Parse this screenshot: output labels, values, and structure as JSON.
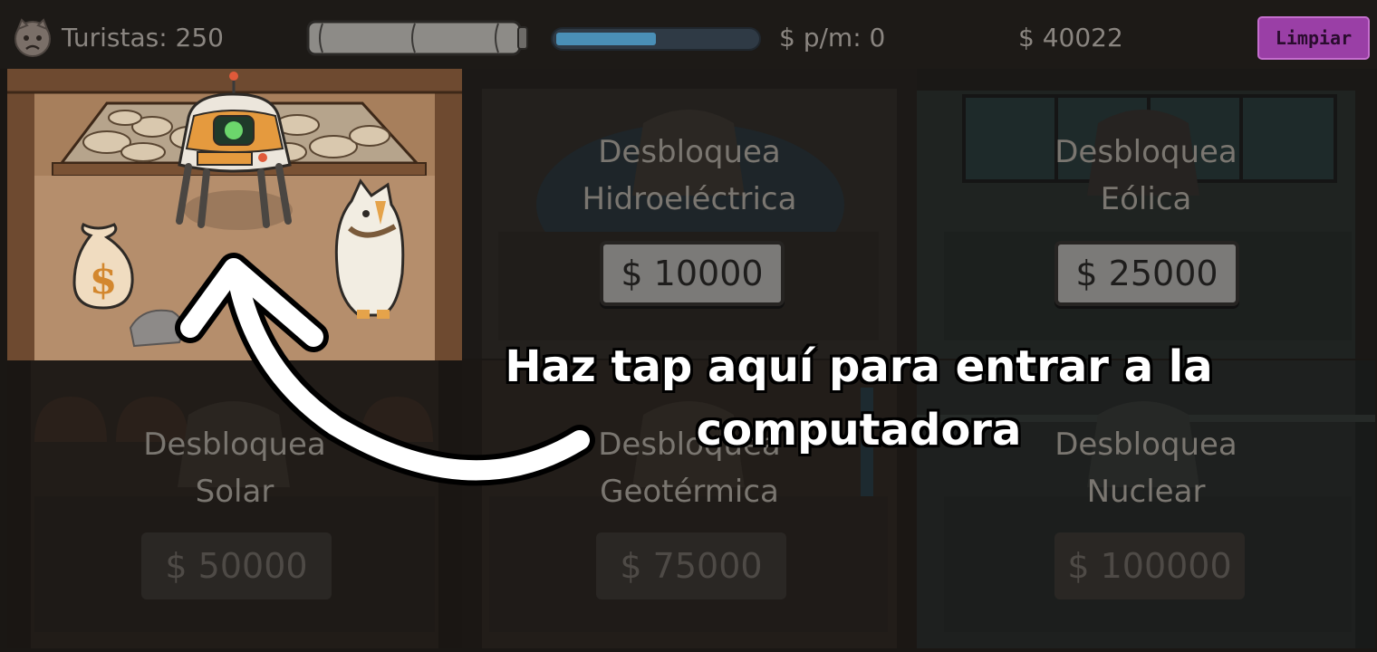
{
  "hud": {
    "tourists_label": "Turistas: 250",
    "per_minute_label": "$ p/m: 0",
    "money_label": "$ 40022",
    "clear_button_label": "Limpiar",
    "progress_fraction": 0.5,
    "face_icon": "sad-face-icon"
  },
  "rooms": {
    "hydro": {
      "line1": "Desbloquea",
      "line2": "Hidroeléctrica",
      "price": "$ 10000"
    },
    "wind": {
      "line1": "Desbloquea",
      "line2": "Eólica",
      "price": "$ 25000"
    },
    "solar": {
      "line1": "Desbloquea",
      "line2": "Solar",
      "price": "$ 50000"
    },
    "geothermal": {
      "line1": "Desbloquea",
      "line2": "Geotérmica",
      "price": "$ 75000"
    },
    "nuclear": {
      "line1": "Desbloquea",
      "line2": "Nuclear",
      "price": "$ 100000"
    }
  },
  "tutorial": {
    "text": "Haz tap aquí para entrar a la computadora"
  },
  "colors": {
    "accent_purple": "#9a3fa6",
    "progress_blue": "#4a8fb6",
    "hud_text": "#8a8580"
  }
}
